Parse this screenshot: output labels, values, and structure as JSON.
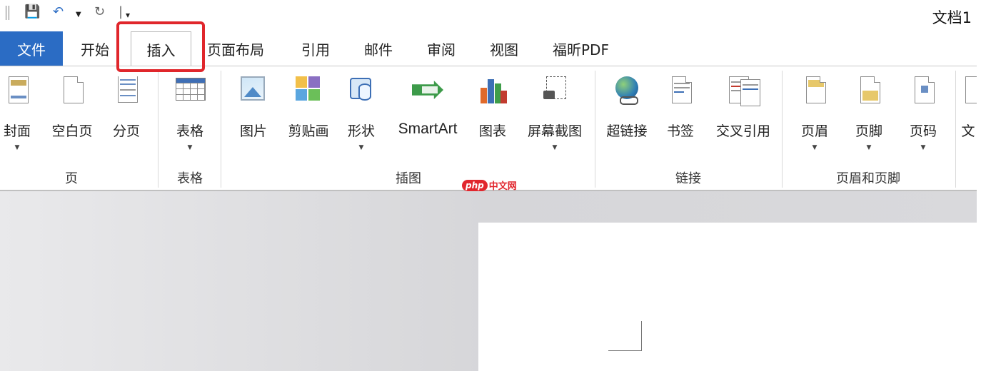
{
  "window": {
    "doc_title": "文档1"
  },
  "quick_access": {
    "save_icon": "save-icon",
    "undo_icon": "undo-icon",
    "redo_icon": "redo-icon",
    "customize_icon": "customize-icon"
  },
  "tabs": {
    "file": "文件",
    "items": [
      "开始",
      "插入",
      "页面布局",
      "引用",
      "邮件",
      "审阅",
      "视图",
      "福昕PDF"
    ],
    "active": "插入"
  },
  "ribbon": {
    "groups": [
      {
        "label": "页",
        "commands": [
          "封面",
          "空白页",
          "分页"
        ]
      },
      {
        "label": "表格",
        "commands": [
          "表格"
        ]
      },
      {
        "label": "插图",
        "commands": [
          "图片",
          "剪贴画",
          "形状",
          "SmartArt",
          "图表",
          "屏幕截图"
        ]
      },
      {
        "label": "链接",
        "commands": [
          "超链接",
          "书签",
          "交叉引用"
        ]
      },
      {
        "label": "页眉和页脚",
        "commands": [
          "页眉",
          "页脚",
          "页码"
        ]
      },
      {
        "label": "",
        "commands": [
          "文"
        ]
      }
    ]
  },
  "watermark": {
    "badge": "php",
    "text": "中文网"
  },
  "colors": {
    "file_tab": "#2b6cc4",
    "highlight": "#e0262b"
  }
}
